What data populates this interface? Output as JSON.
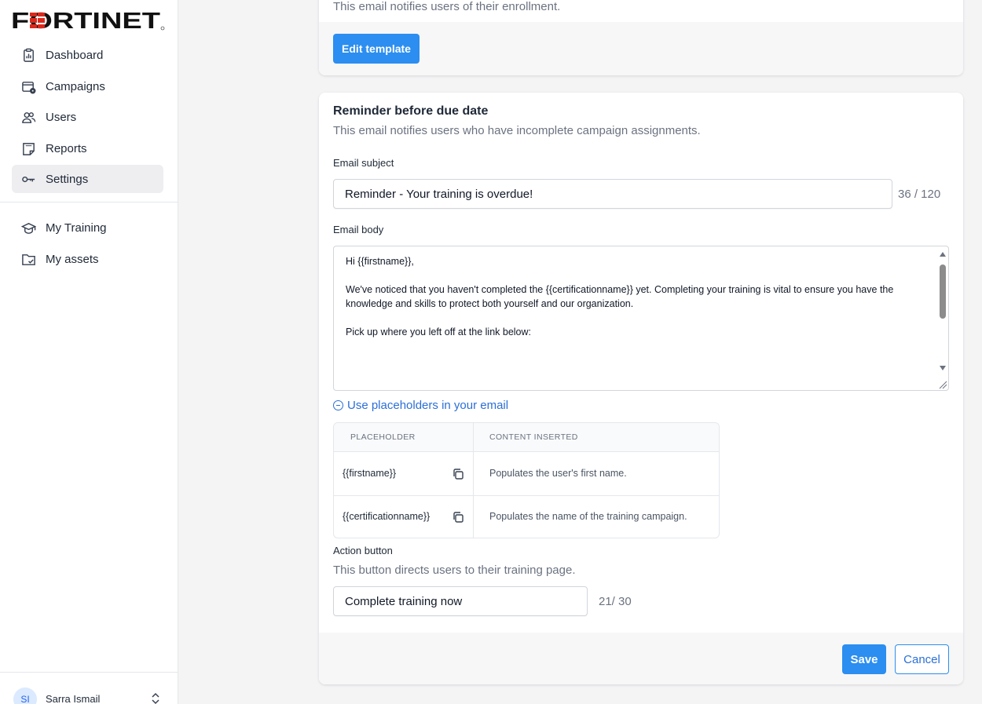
{
  "brand": {
    "logo_text": "FORTINET"
  },
  "sidebar": {
    "items": [
      {
        "label": "Dashboard",
        "icon": "dashboard-icon"
      },
      {
        "label": "Campaigns",
        "icon": "campaigns-icon"
      },
      {
        "label": "Users",
        "icon": "users-icon"
      },
      {
        "label": "Reports",
        "icon": "reports-icon"
      },
      {
        "label": "Settings",
        "icon": "key-icon",
        "active": true
      }
    ],
    "secondary_items": [
      {
        "label": "My Training",
        "icon": "graduation-cap-icon"
      },
      {
        "label": "My assets",
        "icon": "folder-check-icon"
      }
    ],
    "user": {
      "initials": "SI",
      "name": "Sarra Ismail"
    }
  },
  "enrollment_card": {
    "description": "This email notifies users of their enrollment.",
    "edit_button": "Edit template"
  },
  "reminder": {
    "title": "Reminder before due date",
    "description": "This email notifies users who have incomplete campaign assignments.",
    "subject_label": "Email subject",
    "subject_value": "Reminder - Your training is overdue!",
    "subject_counter": "36 / 120",
    "body_label": "Email body",
    "body_value": "Hi {{firstname}},\n\nWe've noticed that you haven't completed the {{certificationname}} yet. Completing your training is vital to ensure you have the knowledge and skills to protect both yourself and our organization.\n\nPick up where you left off at the link below:",
    "placeholders_link": "Use placeholders in your email",
    "table": {
      "headers": [
        "PLACEHOLDER",
        "CONTENT INSERTED"
      ],
      "rows": [
        {
          "placeholder": "{{firstname}}",
          "content": "Populates the user's first name."
        },
        {
          "placeholder": "{{certificationname}}",
          "content": "Populates the name of the training campaign."
        }
      ]
    },
    "action_label": "Action button",
    "action_description": "This button directs users to their training page.",
    "action_value": "Complete training now",
    "action_counter": "21/ 30",
    "save_button": "Save",
    "cancel_button": "Cancel"
  },
  "colors": {
    "primary": "#2b8ef0",
    "logo_red": "#da291c",
    "link": "#2b6fd6"
  }
}
